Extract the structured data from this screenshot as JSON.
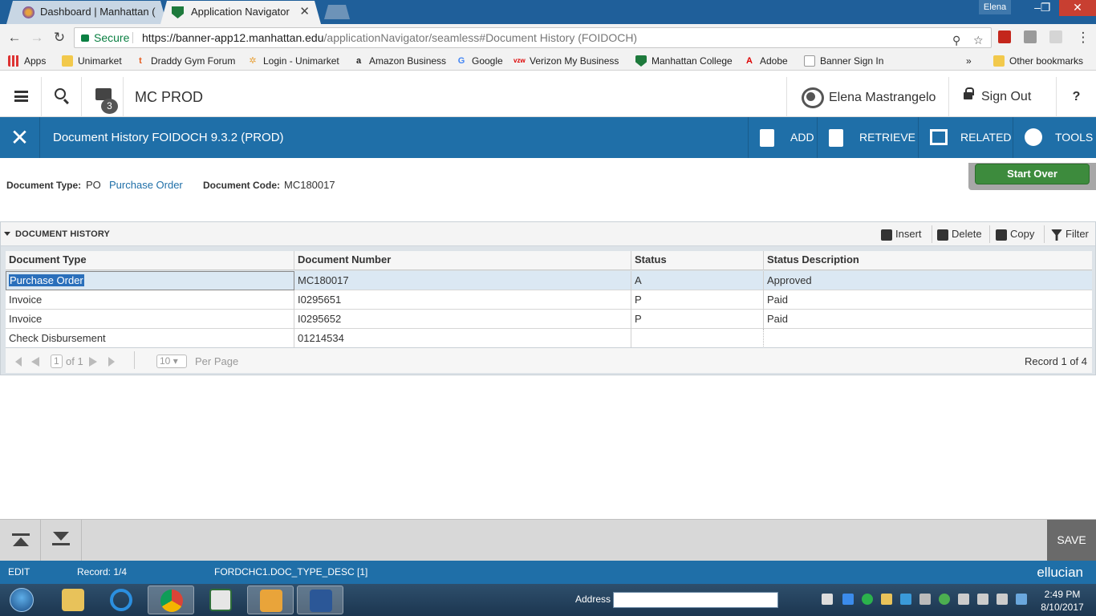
{
  "browser": {
    "tabs": [
      {
        "title": "Dashboard | Manhattan (",
        "active": false
      },
      {
        "title": "Application Navigator",
        "active": true
      }
    ],
    "profile_name": "Elena",
    "secure_label": "Secure",
    "url_main": "https://banner-app12.manhattan.edu",
    "url_rest": "/applicationNavigator/seamless#Document History (FOIDOCH)",
    "bookmarks": [
      "Apps",
      "Unimarket",
      "Draddy Gym Forum",
      "Login - Unimarket",
      "Amazon Business",
      "Google",
      "Verizon My Business",
      "Manhattan College",
      "Adobe",
      "Banner Sign In"
    ],
    "bookmarks_overflow": "»",
    "other_bookmarks": "Other bookmarks"
  },
  "banner": {
    "recent_count": "3",
    "instance": "MC PROD",
    "user_name": "Elena Mastrangelo",
    "sign_out": "Sign Out",
    "help": "?"
  },
  "page": {
    "title": "Document History FOIDOCH 9.3.2 (PROD)",
    "actions": {
      "add": "ADD",
      "retrieve": "RETRIEVE",
      "related": "RELATED",
      "tools": "TOOLS"
    }
  },
  "key_block": {
    "doc_type_label": "Document Type:",
    "doc_type_code": "PO",
    "doc_type_desc": "Purchase Order",
    "doc_code_label": "Document Code:",
    "doc_code_value": "MC180017",
    "start_over": "Start Over"
  },
  "section": {
    "title": "DOCUMENT HISTORY",
    "insert": "Insert",
    "delete": "Delete",
    "copy": "Copy",
    "filter": "Filter",
    "columns": [
      "Document Type",
      "Document Number",
      "Status",
      "Status Description"
    ],
    "rows": [
      [
        "Purchase Order",
        "MC180017",
        "A",
        "Approved"
      ],
      [
        "Invoice",
        "I0295651",
        "P",
        "Paid"
      ],
      [
        "Invoice",
        "I0295652",
        "P",
        "Paid"
      ],
      [
        "Check Disbursement",
        "01214534",
        "",
        ""
      ]
    ],
    "pager": {
      "page": "1",
      "of": "of 1",
      "per_page_value": "10",
      "per_page_label": "Per Page",
      "record": "Record 1 of 4"
    }
  },
  "bottom": {
    "save": "SAVE"
  },
  "status_bar": {
    "mode": "EDIT",
    "record": "Record: 1/4",
    "field": "FORDCHC1.DOC_TYPE_DESC [1]",
    "brand": "ellucian"
  },
  "taskbar": {
    "address_label": "Address",
    "time": "2:49 PM",
    "date": "8/10/2017"
  },
  "colors": {
    "banner_blue": "#1f6fa8",
    "start_over_green": "#3d8b3d",
    "link_blue": "#1f6fa8"
  }
}
